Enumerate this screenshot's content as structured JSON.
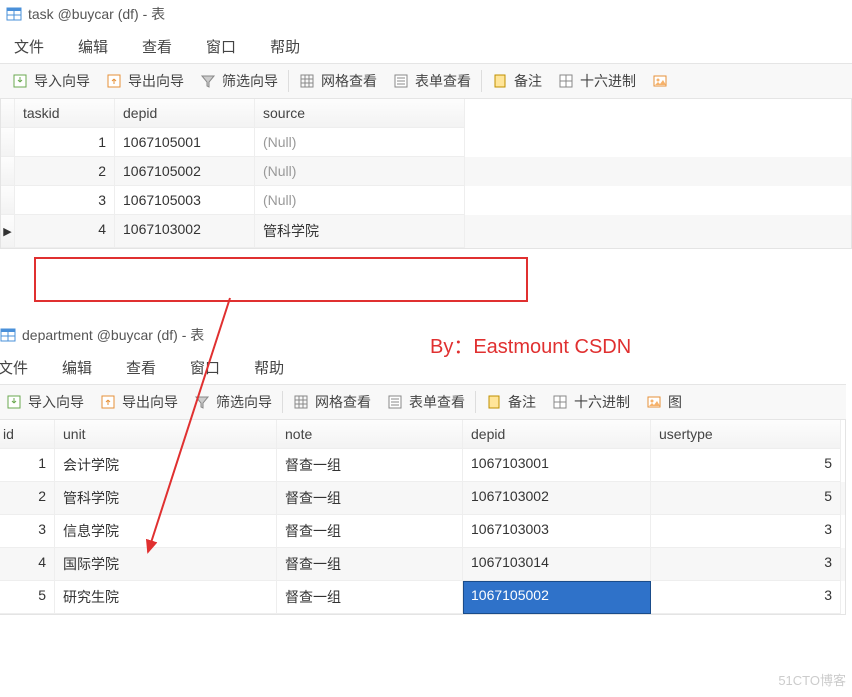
{
  "topWindow": {
    "title": "task @buycar (df) - 表",
    "menu": [
      "文件",
      "编辑",
      "查看",
      "窗口",
      "帮助"
    ],
    "toolbar": {
      "import": "导入向导",
      "export": "导出向导",
      "filter": "筛选向导",
      "gridview": "网格查看",
      "formview": "表单查看",
      "memo": "备注",
      "hex": "十六进制"
    },
    "cols": {
      "taskid": "taskid",
      "depid": "depid",
      "source": "source"
    },
    "rows": [
      {
        "taskid": "1",
        "depid": "1067105001",
        "source": "(Null)",
        "null": true
      },
      {
        "taskid": "2",
        "depid": "1067105002",
        "source": "(Null)",
        "null": true
      },
      {
        "taskid": "3",
        "depid": "1067105003",
        "source": "(Null)",
        "null": true
      },
      {
        "taskid": "4",
        "depid": "1067103002",
        "source": "管科学院",
        "null": false
      }
    ]
  },
  "byline": "By：Eastmount CSDN",
  "bottomWindow": {
    "title": "department @buycar (df) - 表",
    "menu": [
      "文件",
      "编辑",
      "查看",
      "窗口",
      "帮助"
    ],
    "toolbar": {
      "import": "导入向导",
      "export": "导出向导",
      "filter": "筛选向导",
      "gridview": "网格查看",
      "formview": "表单查看",
      "memo": "备注",
      "hex": "十六进制",
      "image": "图"
    },
    "cols": {
      "id": "id",
      "unit": "unit",
      "note": "note",
      "depid": "depid",
      "usertype": "usertype"
    },
    "rows": [
      {
        "id": "1",
        "unit": "会计学院",
        "note": "督查一组",
        "depid": "1067103001",
        "usertype": "5"
      },
      {
        "id": "2",
        "unit": "管科学院",
        "note": "督查一组",
        "depid": "1067103002",
        "usertype": "5"
      },
      {
        "id": "3",
        "unit": "信息学院",
        "note": "督查一组",
        "depid": "1067103003",
        "usertype": "3"
      },
      {
        "id": "4",
        "unit": "国际学院",
        "note": "督查一组",
        "depid": "1067103014",
        "usertype": "3"
      },
      {
        "id": "5",
        "unit": "研究生院",
        "note": "督查一组",
        "depid": "1067105002",
        "usertype": "3"
      }
    ],
    "selected": {
      "row": 4,
      "col": "depid"
    }
  },
  "watermark": "51CTO博客"
}
